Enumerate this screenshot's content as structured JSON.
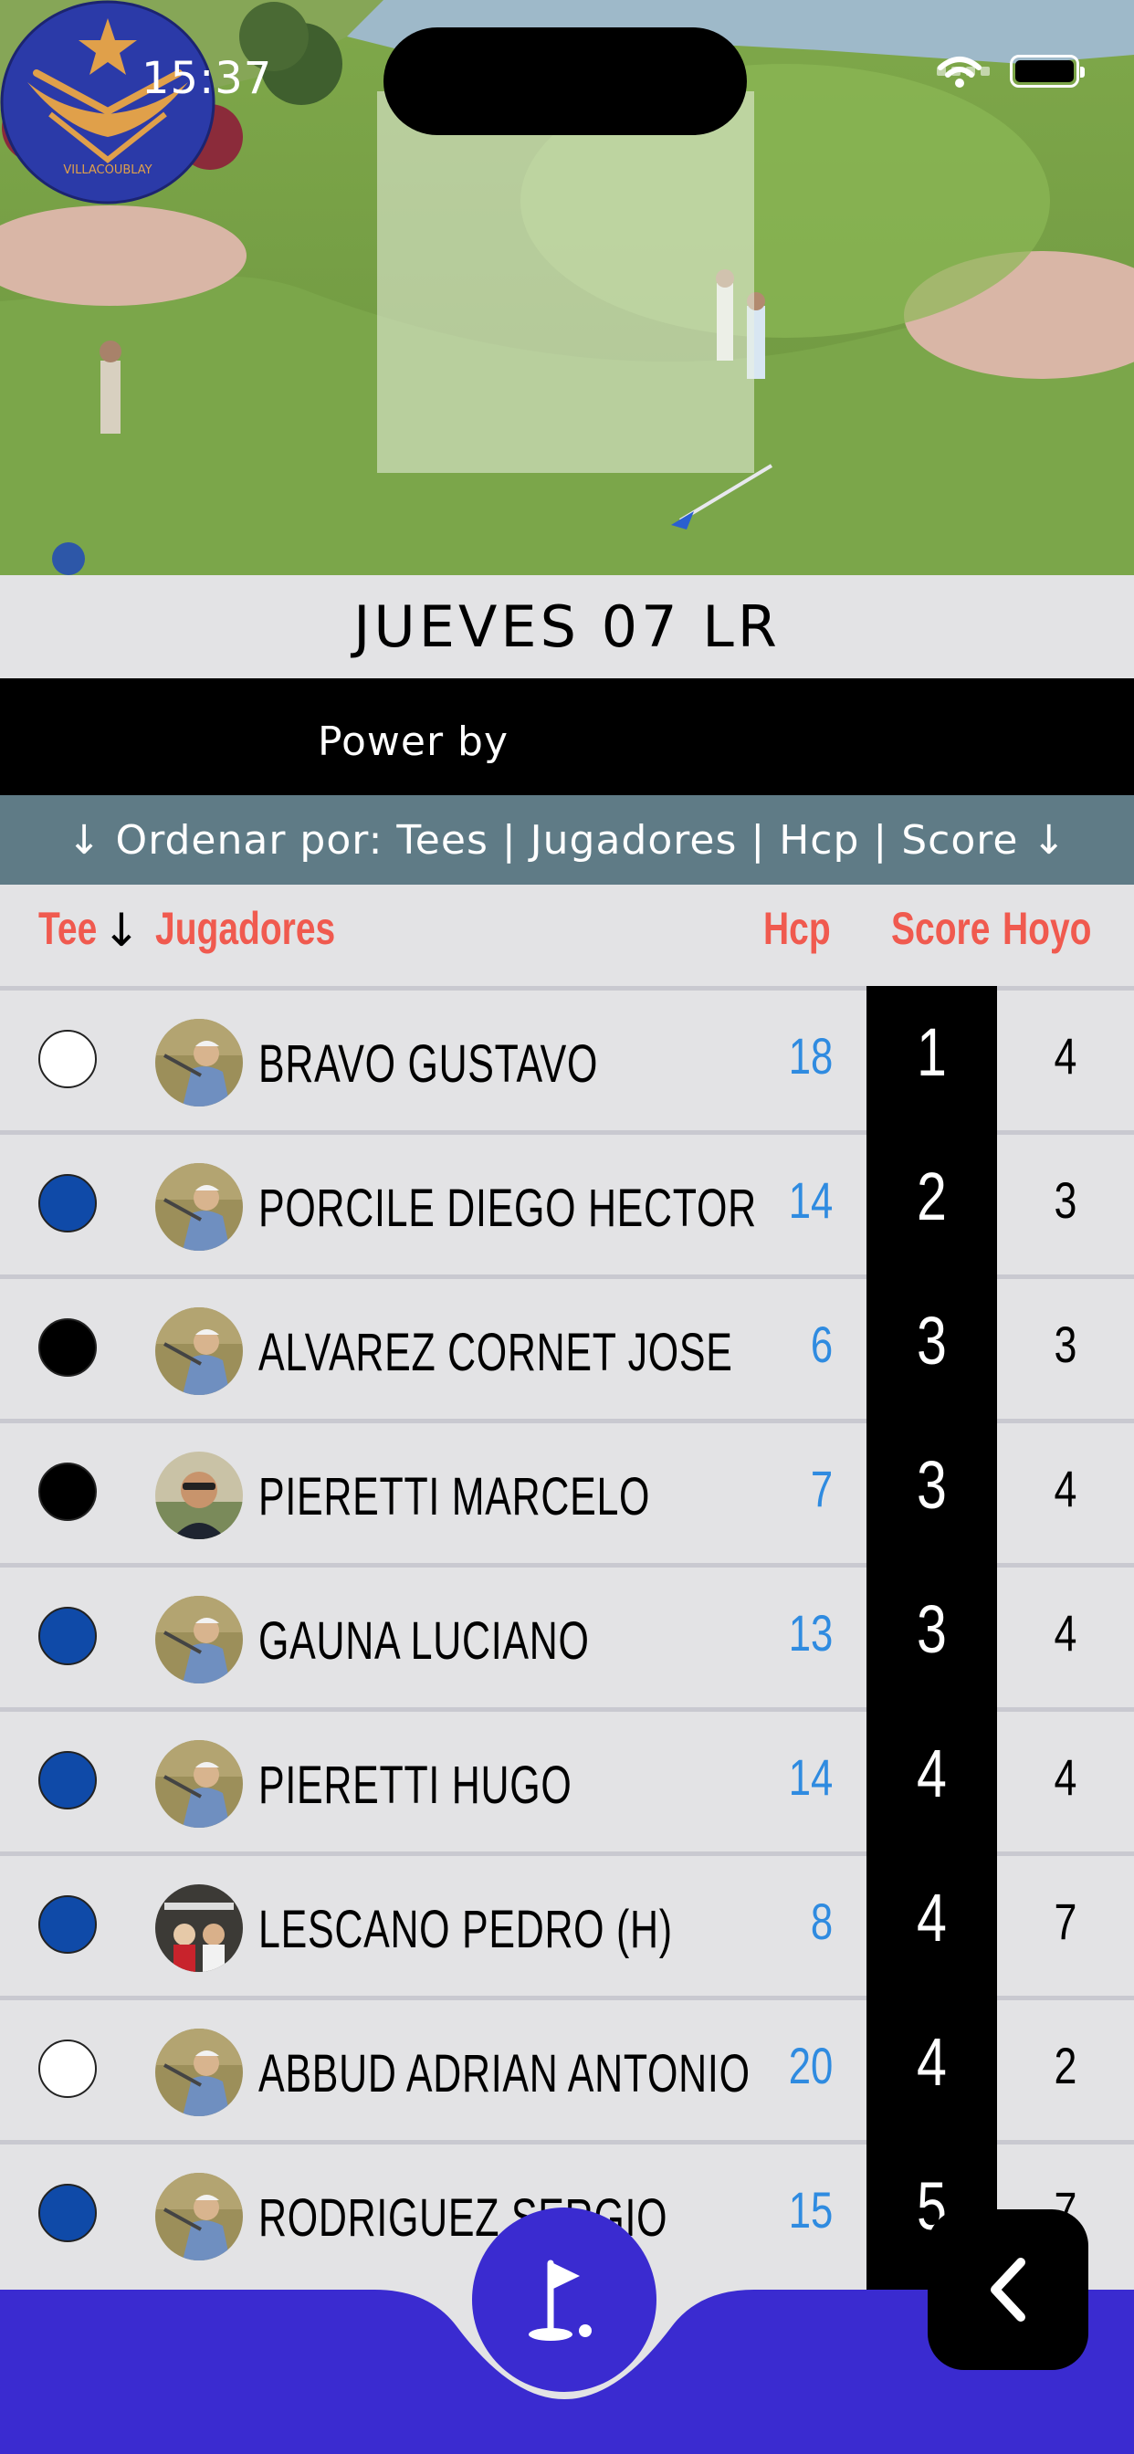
{
  "status_bar": {
    "time": "15:37"
  },
  "event": {
    "title": "JUEVES 07 LR"
  },
  "sponsor": {
    "label": "Power by"
  },
  "logo": {
    "text": "VILLACOUBLAY"
  },
  "sort_bar": {
    "label": "↓ Ordenar por: Tees | Jugadores | Hcp | Score ↓"
  },
  "columns": {
    "tee": "Tee",
    "tee_arrow": "↓",
    "players": "Jugadores",
    "hcp": "Hcp",
    "score": "Score",
    "hole": "Hoyo"
  },
  "colors": {
    "accent_red": "#f05a4f",
    "hcp_blue": "#2f8be0",
    "nav_purple": "#3a2bd0",
    "sort_bar": "#5f7b86"
  },
  "players": [
    {
      "tee": "white",
      "tee_color": "#ffffff",
      "avatar": "golfer-avatar",
      "name": "BRAVO GUSTAVO",
      "hcp": "18",
      "score": "1",
      "hole": "4"
    },
    {
      "tee": "blue",
      "tee_color": "#0f4aa8",
      "avatar": "golfer-avatar",
      "name": "PORCILE DIEGO HECTOR",
      "hcp": "14",
      "score": "2",
      "hole": "3"
    },
    {
      "tee": "black",
      "tee_color": "#000000",
      "avatar": "golfer-avatar",
      "name": "ALVAREZ CORNET JOSE",
      "hcp": "6",
      "score": "3",
      "hole": "3"
    },
    {
      "tee": "black",
      "tee_color": "#000000",
      "avatar": "portrait-avatar",
      "name": "PIERETTI MARCELO",
      "hcp": "7",
      "score": "3",
      "hole": "4"
    },
    {
      "tee": "blue",
      "tee_color": "#0f4aa8",
      "avatar": "golfer-avatar",
      "name": "GAUNA LUCIANO",
      "hcp": "13",
      "score": "3",
      "hole": "4"
    },
    {
      "tee": "blue",
      "tee_color": "#0f4aa8",
      "avatar": "golfer-avatar",
      "name": "PIERETTI HUGO",
      "hcp": "14",
      "score": "4",
      "hole": "4"
    },
    {
      "tee": "blue",
      "tee_color": "#0f4aa8",
      "avatar": "cart-avatar",
      "name": "LESCANO PEDRO (H)",
      "hcp": "8",
      "score": "4",
      "hole": "7"
    },
    {
      "tee": "white",
      "tee_color": "#ffffff",
      "avatar": "golfer-avatar",
      "name": "ABBUD ADRIAN ANTONIO",
      "hcp": "20",
      "score": "4",
      "hole": "2"
    },
    {
      "tee": "blue",
      "tee_color": "#0f4aa8",
      "avatar": "golfer-avatar",
      "name": "RODRIGUEZ SERGIO",
      "hcp": "15",
      "score": "5",
      "hole": "7"
    }
  ],
  "nav": {
    "center_icon": "golf-flag-icon",
    "back_icon": "chevron-left-icon"
  }
}
